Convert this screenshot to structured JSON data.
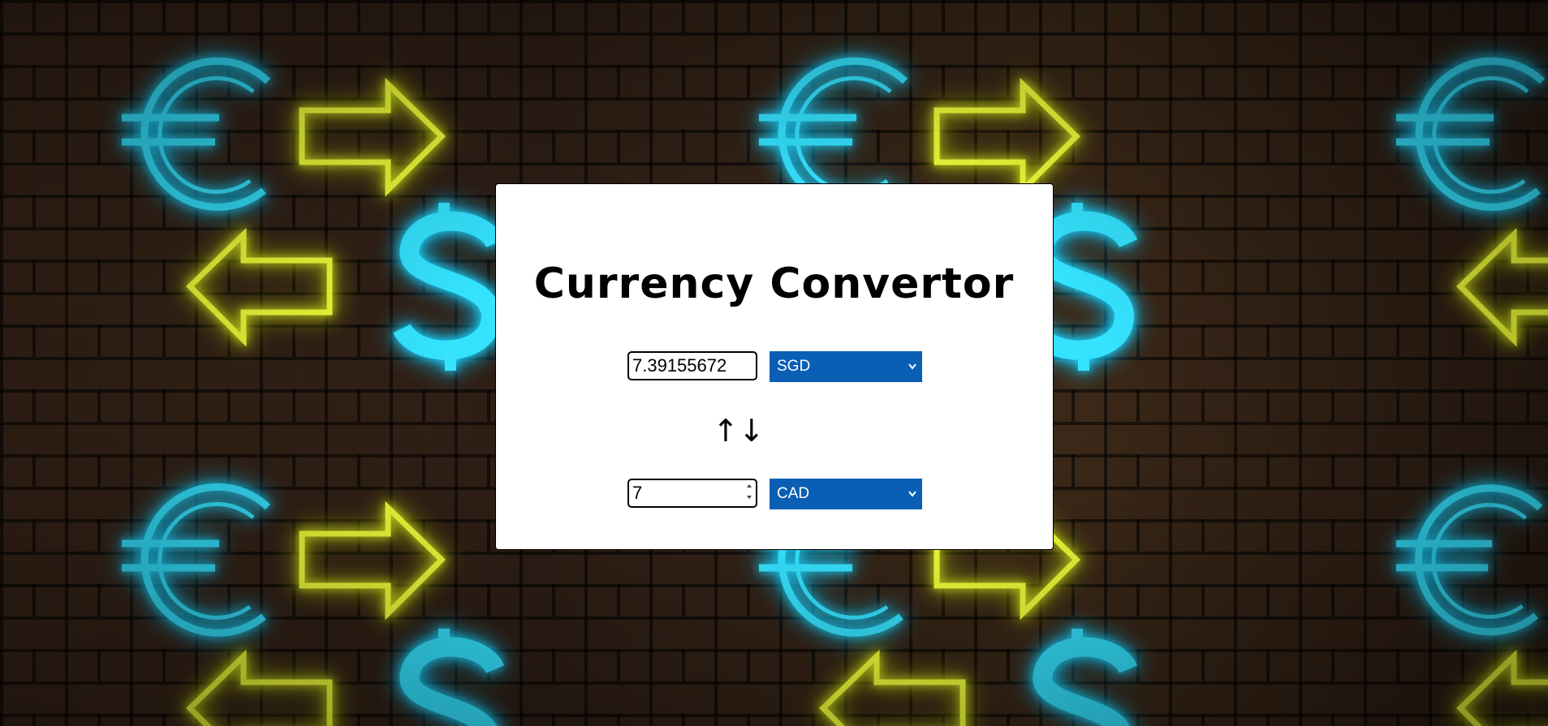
{
  "app": {
    "title": "Currency Convertor"
  },
  "converter": {
    "from": {
      "amount": "7.39155672",
      "currency": "SGD"
    },
    "swap_symbol": "↑↓",
    "to": {
      "amount": "7",
      "currency": "CAD"
    }
  },
  "colors": {
    "select_bg": "#0a5fb4",
    "neon_cyan": "#35e3ff",
    "neon_yellow": "#f3ff3a"
  },
  "icons": {
    "swap": "swap-arrows-icon",
    "dropdown": "chevron-down-icon",
    "background_euro": "euro-neon-icon",
    "background_dollar": "dollar-neon-icon",
    "background_arrow_right": "arrow-right-neon-icon",
    "background_arrow_left": "arrow-left-neon-icon"
  }
}
